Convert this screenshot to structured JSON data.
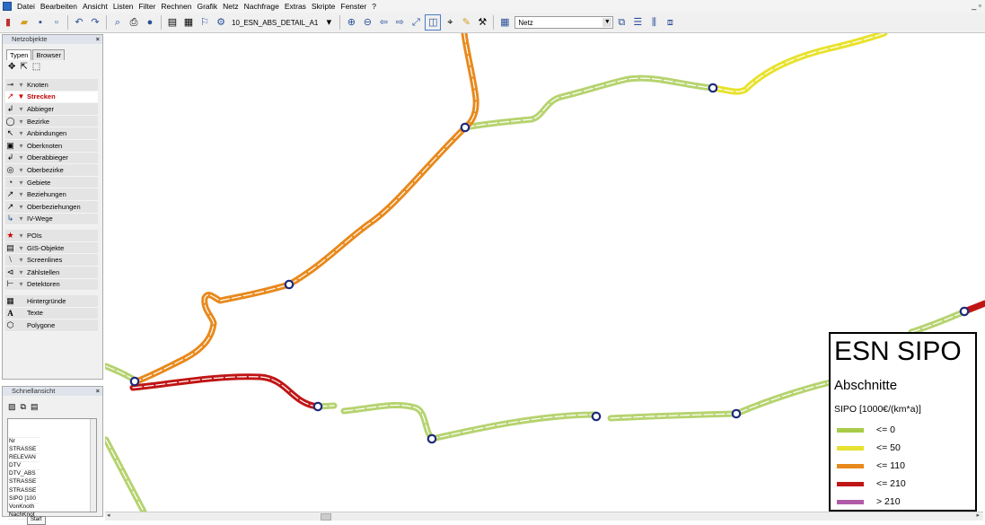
{
  "menubar": {
    "items": [
      "Datei",
      "Bearbeiten",
      "Ansicht",
      "Listen",
      "Filter",
      "Rechnen",
      "Grafik",
      "Netz",
      "Nachfrage",
      "Extras",
      "Skripte",
      "Fenster",
      "?"
    ],
    "window_controls": "_ ▫"
  },
  "toolbar": {
    "layer_name": "10_ESN_ABS_DETAIL_A1",
    "net_label": "Netz"
  },
  "netzobjekte_panel": {
    "title": "Netzobjekte",
    "tabs": [
      "Typen",
      "Browser"
    ],
    "items": [
      {
        "label": "Knoten",
        "icon": "⊸",
        "selected": false
      },
      {
        "label": "Strecken",
        "icon": "↗",
        "selected": true
      },
      {
        "label": "Abbieger",
        "icon": "↲",
        "selected": false
      },
      {
        "label": "Bezirke",
        "icon": "◯",
        "selected": false
      },
      {
        "label": "Anbindungen",
        "icon": "↖",
        "selected": false
      },
      {
        "label": "Oberknoten",
        "icon": "▣",
        "selected": false
      },
      {
        "label": "Oberabbieger",
        "icon": "↲",
        "selected": false
      },
      {
        "label": "Oberbezirke",
        "icon": "◎",
        "selected": false
      },
      {
        "label": "Gebiete",
        "icon": "◔",
        "selected": false
      },
      {
        "label": "Beziehungen",
        "icon": "↗",
        "selected": false
      },
      {
        "label": "Oberbeziehungen",
        "icon": "↗",
        "selected": false
      },
      {
        "label": "IV-Wege",
        "icon": "↳",
        "selected": false
      }
    ],
    "items2": [
      {
        "label": "POIs",
        "icon": "★"
      },
      {
        "label": "GIS-Objekte",
        "icon": "▤"
      },
      {
        "label": "Screenlines",
        "icon": "⧵"
      },
      {
        "label": "Zählstellen",
        "icon": "⊲"
      },
      {
        "label": "Detektoren",
        "icon": "⊢"
      }
    ],
    "items3": [
      {
        "label": "Hintergründe",
        "icon": "▦"
      },
      {
        "label": "Texte",
        "icon": "A"
      },
      {
        "label": "Polygone",
        "icon": "⬡"
      }
    ]
  },
  "schnellansicht_panel": {
    "title": "Schnellansicht",
    "rows": [
      "Nr",
      "STRASSE",
      "RELEVAN",
      "DTV",
      "DTV_ABS",
      "STRASSE",
      "STRASSE",
      "SIPO [100",
      "VonKnoth",
      "NachKnot"
    ],
    "start_label": "Start"
  },
  "legend": {
    "title": "ESN SIPO",
    "subtitle": "Abschnitte",
    "unit": "SIPO [1000€/(km*a)]",
    "items": [
      {
        "label": "<= 0",
        "color": "#a8cc48"
      },
      {
        "label": "<= 50",
        "color": "#e6e230"
      },
      {
        "label": "<= 110",
        "color": "#e8891c"
      },
      {
        "label": "<= 210",
        "color": "#c01515"
      },
      {
        "label": "> 210",
        "color": "#b05aa8"
      }
    ]
  },
  "map": {
    "colors": {
      "green": "#b6d36f",
      "yellow": "#e8e22c",
      "orange": "#e8891c",
      "red": "#c01515",
      "node": "#1e2a7a"
    }
  }
}
